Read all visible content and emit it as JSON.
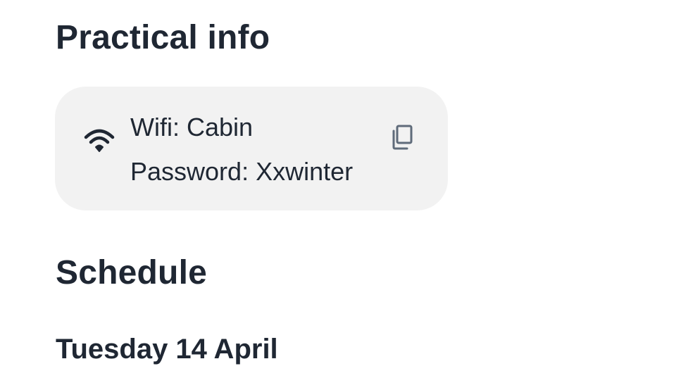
{
  "practical_info": {
    "title": "Practical info",
    "wifi": {
      "name_text": "Wifi: Cabin",
      "password_text": "Password: Xxwinter",
      "icon": "wifi-icon",
      "copy_icon": "copy-icon"
    }
  },
  "schedule": {
    "title": "Schedule",
    "day": "Tuesday 14 April"
  },
  "colors": {
    "text": "#1f2733",
    "card_background": "#f2f2f2",
    "icon_muted": "#5f6b7a"
  }
}
